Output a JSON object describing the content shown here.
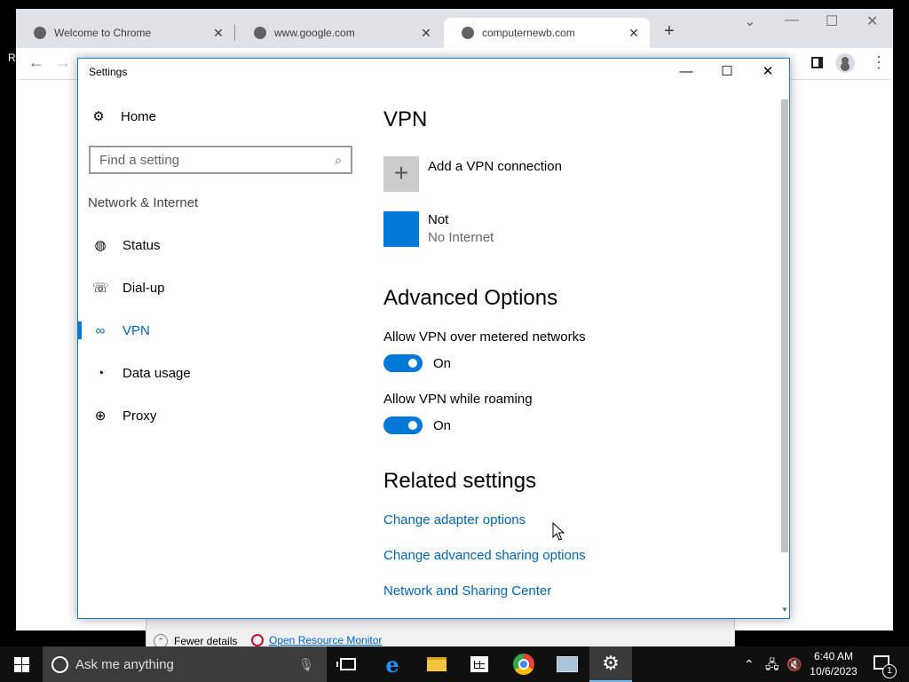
{
  "chrome": {
    "tabs": [
      {
        "title": "Welcome to Chrome"
      },
      {
        "title": "www.google.com"
      },
      {
        "title": "computernewb.com"
      }
    ],
    "new_tab_label": "+",
    "partial_text": "R"
  },
  "task_manager": {
    "fewer_details": "Fewer details",
    "resource_monitor_link": "Open Resource Monitor"
  },
  "settings": {
    "window_title": "Settings",
    "home_label": "Home",
    "search": {
      "placeholder": "Find a setting"
    },
    "section_label": "Network & Internet",
    "nav_items": [
      {
        "label": "Status",
        "icon": "globe-status-icon"
      },
      {
        "label": "Dial-up",
        "icon": "dialup-icon"
      },
      {
        "label": "VPN",
        "icon": "vpn-icon",
        "selected": true
      },
      {
        "label": "Data usage",
        "icon": "pie-chart-icon"
      },
      {
        "label": "Proxy",
        "icon": "globe-icon"
      }
    ],
    "page_title": "VPN",
    "add_vpn_label": "Add a VPN connection",
    "connection": {
      "name": "Not",
      "status": "No Internet"
    },
    "advanced_title": "Advanced Options",
    "options": [
      {
        "label": "Allow VPN over metered networks",
        "state": "On"
      },
      {
        "label": "Allow VPN while roaming",
        "state": "On"
      }
    ],
    "related_title": "Related settings",
    "related_links": [
      "Change adapter options",
      "Change advanced sharing options",
      "Network and Sharing Center"
    ]
  },
  "taskbar": {
    "search_placeholder": "Ask me anything",
    "clock_time": "6:40 AM",
    "clock_date": "10/6/2023",
    "notification_count": "1"
  },
  "colors": {
    "accent": "#0078d7",
    "link": "#0063b1"
  }
}
